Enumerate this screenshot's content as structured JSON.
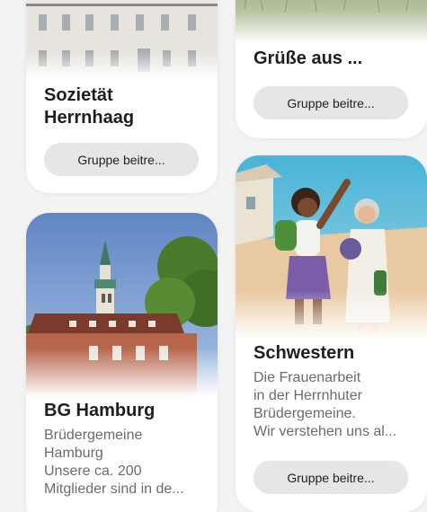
{
  "cards": [
    {
      "id": "societaet",
      "title_line1": "Sozietät",
      "title_line2": "Herrnhaag",
      "button_label": "Gruppe beitre..."
    },
    {
      "id": "gruesse",
      "title_line1": "Grüße aus ...",
      "button_label": "Gruppe beitre..."
    },
    {
      "id": "hamburg",
      "title_line1": "BG Hamburg",
      "desc_lines": [
        "Brüdergemeine",
        "Hamburg",
        "Unsere ca. 200",
        "Mitglieder sind in de..."
      ]
    },
    {
      "id": "schwestern",
      "title_line1": "Schwestern",
      "desc_lines": [
        "Die Frauenarbeit",
        "in der Herrnhuter",
        "Brüdergemeine.",
        "Wir verstehen uns al..."
      ],
      "button_label": "Gruppe beitre..."
    }
  ],
  "colors": {
    "background": "#f3f3f4",
    "card": "#ffffff",
    "button": "#e6e6e8",
    "title": "#1e1e1e",
    "description": "#6b6b6b"
  }
}
